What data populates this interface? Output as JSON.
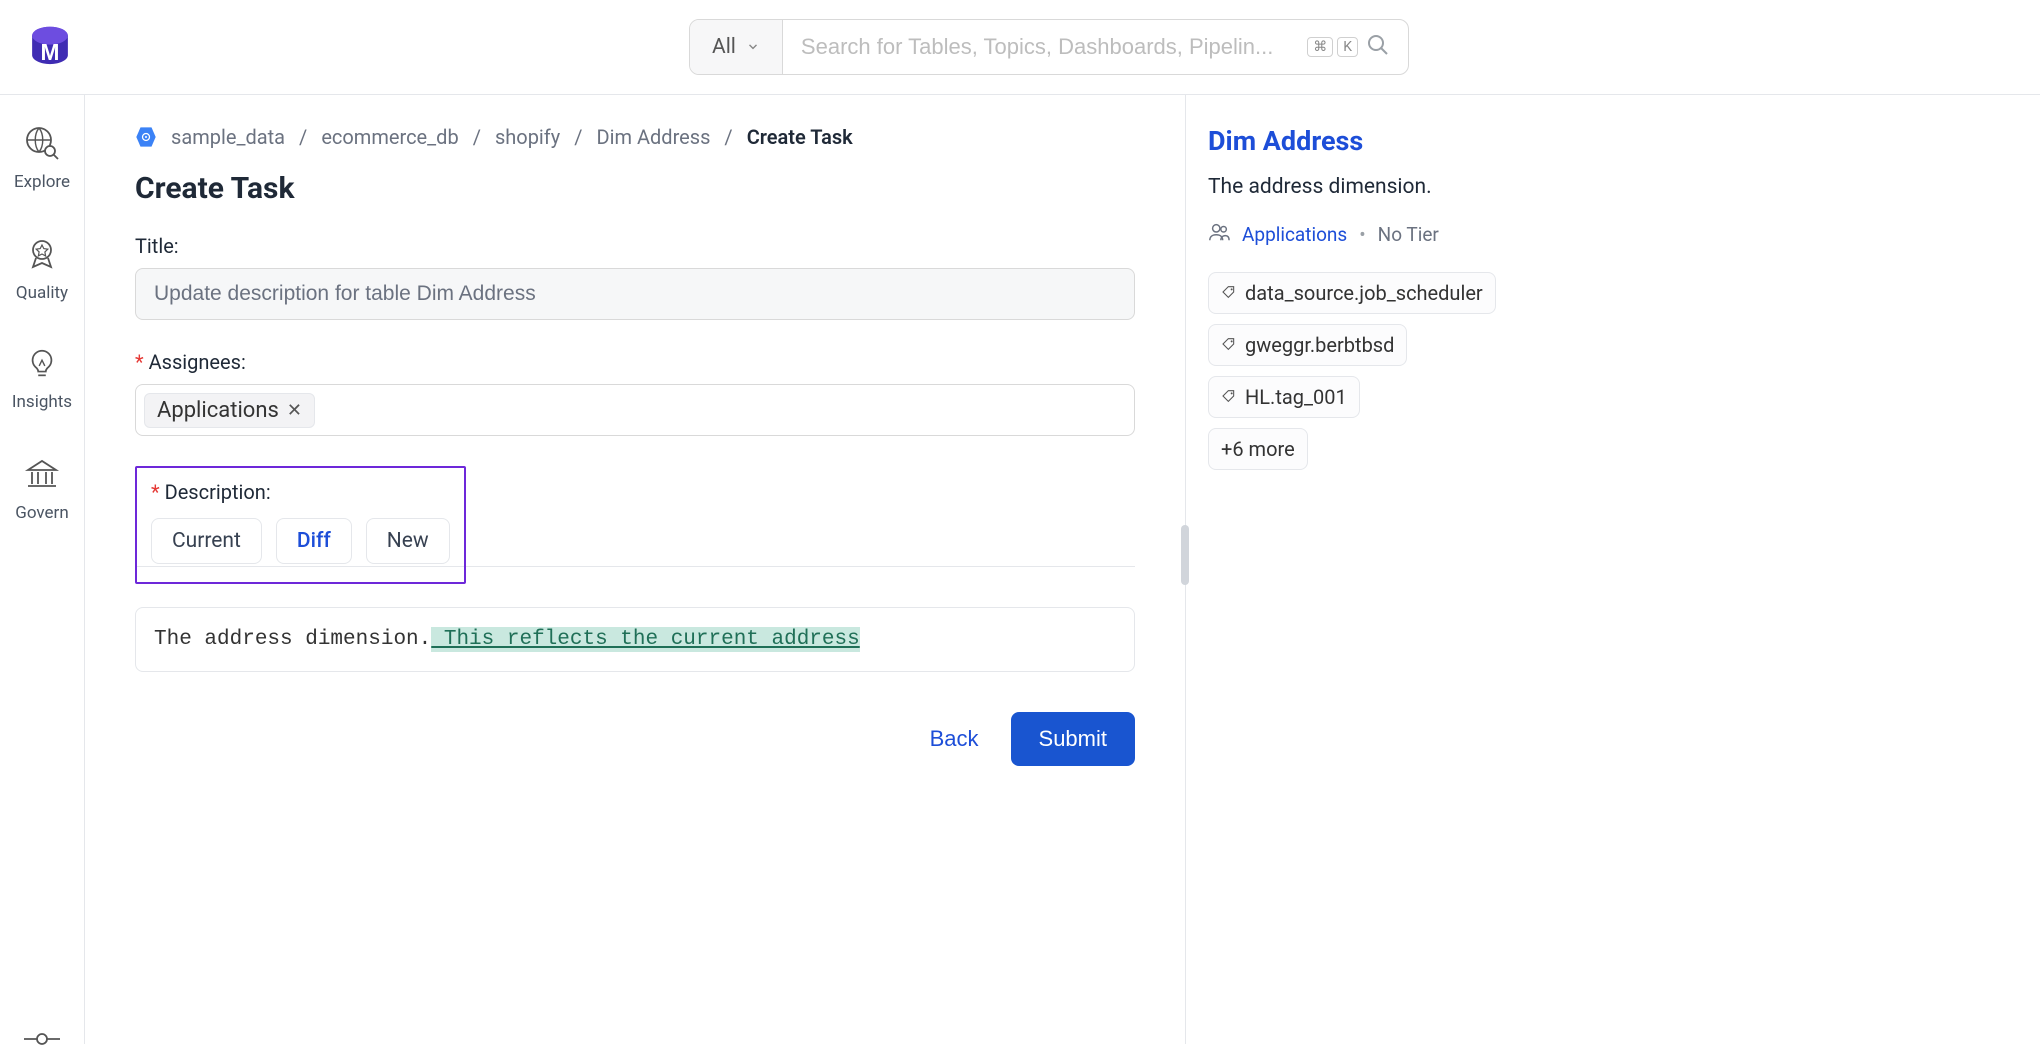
{
  "header": {
    "search_category": "All",
    "search_placeholder": "Search for Tables, Topics, Dashboards, Pipelin...",
    "kbd_meta": "⌘",
    "kbd_key": "K"
  },
  "sidebar": {
    "items": [
      {
        "label": "Explore"
      },
      {
        "label": "Quality"
      },
      {
        "label": "Insights"
      },
      {
        "label": "Govern"
      }
    ]
  },
  "breadcrumb": {
    "items": [
      "sample_data",
      "ecommerce_db",
      "shopify",
      "Dim Address",
      "Create Task"
    ]
  },
  "page": {
    "title": "Create Task"
  },
  "form": {
    "title_label": "Title:",
    "title_value": "Update description for table Dim Address",
    "assignees_label": "Assignees:",
    "assignees": [
      {
        "name": "Applications"
      }
    ],
    "description_label": "Description:",
    "tabs": {
      "current": "Current",
      "diff": "Diff",
      "newt": "New"
    },
    "diff_original": "The address dimension.",
    "diff_added": " This reflects the current address",
    "back": "Back",
    "submit": "Submit"
  },
  "rightPanel": {
    "title": "Dim Address",
    "description": "The address dimension.",
    "owner": "Applications",
    "tier": "No Tier",
    "tags": [
      "data_source.job_scheduler",
      "gweggr.berbtbsd",
      "HL.tag_001"
    ],
    "more": "+6 more"
  }
}
